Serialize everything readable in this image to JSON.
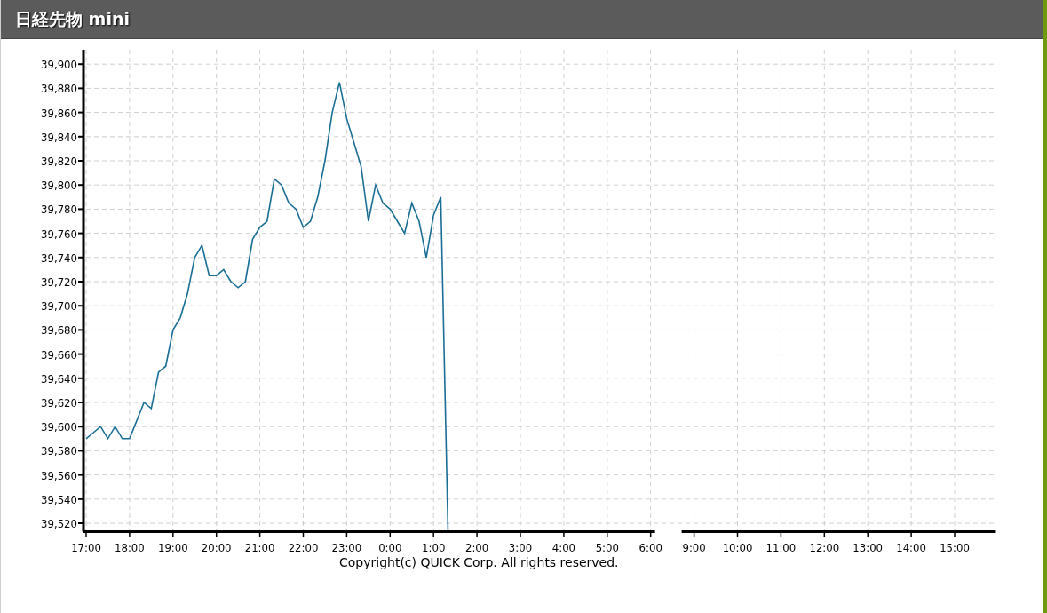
{
  "header": {
    "title": "日経先物 mini"
  },
  "chart": {
    "chart_data": {
      "type": "line",
      "grid": true,
      "ylim": [
        39513,
        39912
      ],
      "categories": [
        "17:00",
        null,
        null,
        null,
        null,
        null,
        "18:00",
        null,
        null,
        null,
        null,
        null,
        "19:00",
        null,
        null,
        null,
        null,
        null,
        "20:00",
        null,
        null,
        null,
        null,
        null,
        "21:00",
        null,
        null,
        null,
        null,
        null,
        "22:00",
        null,
        null,
        null,
        null,
        null,
        "23:00",
        null,
        null,
        null,
        null,
        null,
        "0:00",
        null,
        null,
        null,
        null,
        null,
        "1:00",
        null,
        null,
        null,
        null,
        null,
        "2:00",
        null,
        null,
        null,
        null,
        null,
        "3:00",
        null,
        null,
        null,
        null,
        null,
        "4:00",
        null,
        null,
        null,
        null,
        null,
        "5:00",
        null,
        null,
        null,
        null,
        null,
        "6:00",
        null,
        null,
        null,
        null,
        null,
        "9:00",
        null,
        null,
        null,
        null,
        null,
        "10:00",
        null,
        null,
        null,
        null,
        null,
        "11:00",
        null,
        null,
        null,
        null,
        null,
        "12:00",
        null,
        null,
        null,
        null,
        null,
        "13:00",
        null,
        null,
        null,
        null,
        null,
        "14:00",
        null,
        null,
        null,
        null,
        null,
        "15:00",
        null,
        null,
        null,
        null,
        null
      ],
      "yticks": [
        {
          "value": 39520,
          "label": "39,520"
        },
        {
          "value": 39540,
          "label": "39,540"
        },
        {
          "value": 39560,
          "label": "39,560"
        },
        {
          "value": 39580,
          "label": "39,580"
        },
        {
          "value": 39600,
          "label": "39,600"
        },
        {
          "value": 39620,
          "label": "39,620"
        },
        {
          "value": 39640,
          "label": "39,640"
        },
        {
          "value": 39660,
          "label": "39,660"
        },
        {
          "value": 39680,
          "label": "39,680"
        },
        {
          "value": 39700,
          "label": "39,700"
        },
        {
          "value": 39720,
          "label": "39,720"
        },
        {
          "value": 39740,
          "label": "39,740"
        },
        {
          "value": 39760,
          "label": "39,760"
        },
        {
          "value": 39780,
          "label": "39,780"
        },
        {
          "value": 39800,
          "label": "39,800"
        },
        {
          "value": 39820,
          "label": "39,820"
        },
        {
          "value": 39840,
          "label": "39,840"
        },
        {
          "value": 39860,
          "label": "39,860"
        },
        {
          "value": 39880,
          "label": "39,880"
        },
        {
          "value": 39900,
          "label": "39,900"
        }
      ],
      "series": [
        {
          "color": "#1a6e96",
          "values": [
            39590,
            39595,
            39600,
            39590,
            39600,
            39590,
            39590,
            39605,
            39620,
            39615,
            39645,
            39650,
            39680,
            39690,
            39710,
            39740,
            39750,
            39725,
            39725,
            39730,
            39720,
            39715,
            39720,
            39755,
            39765,
            39770,
            39805,
            39800,
            39785,
            39780,
            39765,
            39770,
            39790,
            39820,
            39860,
            39885,
            39855,
            39835,
            39815,
            39770,
            39800,
            39785,
            39780,
            39770,
            39760,
            39785,
            39770,
            39740,
            39775,
            39790,
            39513,
            null,
            null,
            null,
            null,
            null,
            null,
            null,
            null,
            null,
            null,
            null,
            null,
            null,
            null,
            null,
            null,
            null,
            null,
            null,
            null,
            null,
            null,
            null,
            null,
            null,
            null,
            null,
            null,
            null,
            null,
            null,
            null,
            null,
            null,
            null,
            null,
            null,
            null,
            null,
            null,
            null,
            null,
            null,
            null,
            null,
            null,
            null,
            null,
            null,
            null,
            null,
            null,
            null,
            null,
            null,
            null,
            null,
            null,
            null,
            null,
            null,
            null,
            null,
            null,
            null,
            null,
            null,
            null,
            null,
            null,
            null,
            null,
            null,
            null,
            null
          ]
        }
      ]
    }
  },
  "copyright": "Copyright(c) QUICK Corp. All rights reserved."
}
